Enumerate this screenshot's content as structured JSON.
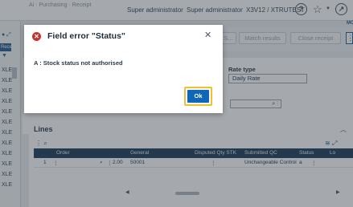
{
  "topbar": {
    "breadcrumb": "Ai · Purchasing · Receipt",
    "user_role": "Super administrator",
    "user_name": "Super administrator",
    "folder": "X3V12 / XTRUTEST",
    "help_icon": "question-circle-icon",
    "favorites_icon": "star-icon",
    "navigate_icon": "compass-icon"
  },
  "left_panel": {
    "tab_label": "Rece",
    "items": [
      "XLE",
      "XLE",
      "XLE",
      "XLE",
      "XLE",
      "XLE",
      "XLE",
      "XLE",
      "XLE",
      "XLE",
      "XLE",
      "XLE"
    ]
  },
  "action_bar": {
    "corner_label": "MO",
    "buttons": [
      {
        "label": "S..."
      },
      {
        "label": "Match results"
      },
      {
        "label": "Close receipt"
      }
    ]
  },
  "form": {
    "rate_type_label": "Rate type",
    "rate_type_value": "Daily Rate"
  },
  "lines": {
    "title": "Lines",
    "columns": [
      "Order",
      "General",
      "Disputed Qty STK",
      "Submitted QC",
      "Status",
      "Lo"
    ],
    "rows": [
      {
        "num": "1",
        "order": "",
        "qty_prefix": "2.00",
        "general": "50001",
        "disputed": "",
        "submitted_qc": "Unchangeable Control",
        "status": "a"
      }
    ]
  },
  "dialog": {
    "title": "Field error \"Status\"",
    "message": "A : Stock status not authorised",
    "ok_label": "Ok",
    "error_color": "#c7332f",
    "button_color": "#0f68b7",
    "focus_color": "#f0c030"
  }
}
